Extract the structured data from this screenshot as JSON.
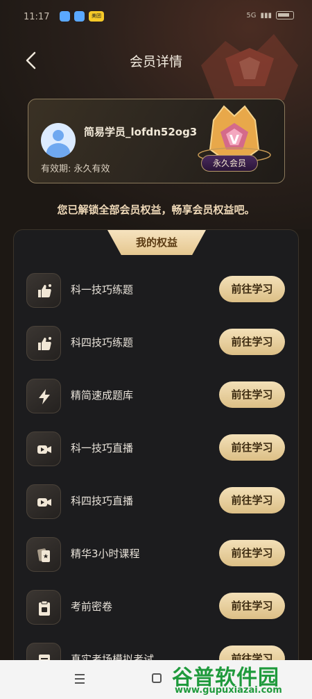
{
  "status_bar": {
    "time": "11:17",
    "app_label": "美团",
    "right_label": "5G"
  },
  "header": {
    "title": "会员详情"
  },
  "member": {
    "username": "简易学员_lofdn52og3",
    "expiry_label": "有效期:",
    "expiry_value": "永久有效",
    "badge": "永久会员",
    "badge_glyph": "V"
  },
  "unlock_message": "您已解锁全部会员权益，畅享会员权益吧。",
  "benefits": {
    "tab_label": "我的权益",
    "items": [
      {
        "label": "科一技巧练题",
        "button": "前往学习",
        "icon": "thumbs-up-icon"
      },
      {
        "label": "科四技巧练题",
        "button": "前往学习",
        "icon": "thumbs-up-icon"
      },
      {
        "label": "精简速成题库",
        "button": "前往学习",
        "icon": "lightning-icon"
      },
      {
        "label": "科一技巧直播",
        "button": "前往学习",
        "icon": "video-icon"
      },
      {
        "label": "科四技巧直播",
        "button": "前往学习",
        "icon": "video-icon"
      },
      {
        "label": "精华3小时课程",
        "button": "前往学习",
        "icon": "cards-icon"
      },
      {
        "label": "考前密卷",
        "button": "前往学习",
        "icon": "clipboard-icon"
      },
      {
        "label": "真实考场模拟考试",
        "button": "前往学习",
        "icon": "document-icon"
      }
    ]
  },
  "watermark": {
    "name": "谷普软件园",
    "url": "www.gupuxiazai.com"
  },
  "colors": {
    "background": "#1d1814",
    "gold": "#e5c78f",
    "panel": "#1c1c1e"
  }
}
